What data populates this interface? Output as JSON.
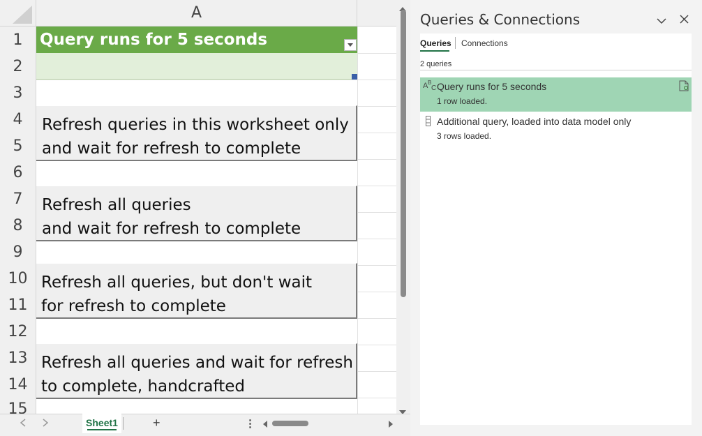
{
  "spreadsheet": {
    "column_header": "A",
    "rows": [
      "1",
      "2",
      "3",
      "4",
      "5",
      "6",
      "7",
      "8",
      "9",
      "10",
      "11",
      "12",
      "13",
      "14",
      "15"
    ],
    "title_cell": "Query runs for 5 seconds",
    "buttons": [
      "Refresh queries in this worksheet only\nand wait for refresh to complete",
      "Refresh all queries\nand wait for refresh to complete",
      "Refresh all queries, but don't wait\nfor refresh to complete",
      "Refresh all queries and wait for refresh\nto complete, handcrafted"
    ],
    "sheet_tab": "Sheet1",
    "add_sheet": "+",
    "more": "⋮",
    "colors": {
      "header_green": "#6aaa48",
      "light_green": "#e2efda"
    }
  },
  "pane": {
    "title": "Queries & Connections",
    "tabs": [
      "Queries",
      "Connections"
    ],
    "count_label": "2 queries",
    "queries": [
      {
        "name": "Query runs for 5 seconds",
        "status": "1 row loaded.",
        "selected": true
      },
      {
        "name": "Additional query, loaded into data model only",
        "status": "3 rows loaded.",
        "selected": false
      }
    ],
    "colors": {
      "selected_bg": "#9fd5b4",
      "tab_underline": "#217346"
    }
  }
}
